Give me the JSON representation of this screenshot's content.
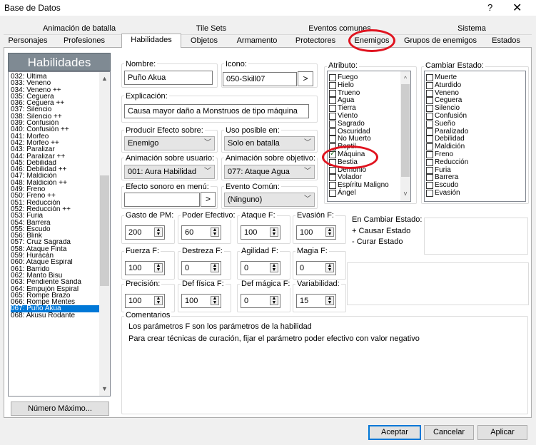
{
  "window": {
    "title": "Base de Datos",
    "help": "?",
    "close": "✕"
  },
  "tabs_row1": [
    "Animación de batalla",
    "Tile Sets",
    "Eventos comunes",
    "Sistema"
  ],
  "tabs_row2": [
    "Personajes",
    "Profesiones",
    "Habilidades",
    "Objetos",
    "Armamento",
    "Protectores",
    "Enemigos",
    "Grupos de enemigos",
    "Estados"
  ],
  "list": {
    "header": "Habilidades",
    "items": [
      "032: Última",
      "033: Veneno",
      "034: Veneno ++",
      "035: Ceguera",
      "036: Ceguera ++",
      "037: Silencio",
      "038: Silencio ++",
      "039: Confusión",
      "040: Confusión ++",
      "041: Morfeo",
      "042: Morfeo ++",
      "043: Paralizar",
      "044: Paralizar ++",
      "045: Debilidad",
      "046: Debilidad ++",
      "047: Maldición",
      "048: Maldición ++",
      "049: Freno",
      "050: Freno ++",
      "051: Reducción",
      "052: Reducción ++",
      "053: Furia",
      "054: Barrera",
      "055: Escudo",
      "056: Blink",
      "057: Cruz Sagrada",
      "058: Ataque Finta",
      "059: Huracán",
      "060: Ataque Espiral",
      "061: Barrido",
      "062: Manto Bisu",
      "063: Pendiente Sanda",
      "064: Empujón Espiral",
      "065: Rompe Brazo",
      "066: Rompe Mentes",
      "067: Puño Akua",
      "068: Akusu Rodante"
    ],
    "selected": "067: Puño Akua",
    "max_button": "Número Máximo..."
  },
  "form": {
    "nombre_label": "Nombre:",
    "nombre": "Puño Akua",
    "icono_label": "Icono:",
    "icono": "050-Skill07",
    "icono_btn": ">",
    "explicacion_label": "Explicación:",
    "explicacion": "Causa mayor daño a Monstruos de tipo máquina",
    "efecto_label": "Producir Efecto sobre:",
    "efecto": "Enemigo",
    "uso_label": "Uso posible en:",
    "uso": "Solo en batalla",
    "anim_user_label": "Animación sobre usuario:",
    "anim_user": "001: Aura Habilidad",
    "anim_target_label": "Animación sobre objetivo:",
    "anim_target": "077: Ataque Agua",
    "sonido_label": "Efecto sonoro en menú:",
    "sonido": "",
    "sonido_btn": ">",
    "evento_label": "Evento Común:",
    "evento": "(Ninguno)"
  },
  "stats": [
    {
      "label": "Gasto de PM:",
      "value": "200"
    },
    {
      "label": "Poder Efectivo:",
      "value": "60"
    },
    {
      "label": "Ataque F:",
      "value": "100"
    },
    {
      "label": "Evasión F:",
      "value": "100"
    },
    {
      "label": "Fuerza F:",
      "value": "100"
    },
    {
      "label": "Destreza F:",
      "value": "0"
    },
    {
      "label": "Agilidad F:",
      "value": "0"
    },
    {
      "label": "Magia F:",
      "value": "0"
    },
    {
      "label": "Precisión:",
      "value": "100"
    },
    {
      "label": "Def física F:",
      "value": "100"
    },
    {
      "label": "Def mágica F:",
      "value": "0"
    },
    {
      "label": "Variabilidad:",
      "value": "15"
    }
  ],
  "atributo": {
    "label": "Atributo:",
    "items": [
      {
        "name": "Fuego",
        "checked": false
      },
      {
        "name": "Hielo",
        "checked": false
      },
      {
        "name": "Trueno",
        "checked": false
      },
      {
        "name": "Agua",
        "checked": false
      },
      {
        "name": "Tierra",
        "checked": false
      },
      {
        "name": "Viento",
        "checked": false
      },
      {
        "name": "Sagrado",
        "checked": false
      },
      {
        "name": "Oscuridad",
        "checked": false
      },
      {
        "name": "No Muerto",
        "checked": false
      },
      {
        "name": "Reptil",
        "checked": false
      },
      {
        "name": "Máquina",
        "checked": true
      },
      {
        "name": "Bestia",
        "checked": false
      },
      {
        "name": "Demonio",
        "checked": false
      },
      {
        "name": "Volador",
        "checked": false
      },
      {
        "name": "Espíritu Maligno",
        "checked": false
      },
      {
        "name": "Ángel",
        "checked": false
      }
    ]
  },
  "estado": {
    "label": "Cambiar Estado:",
    "items": [
      "Muerte",
      "Aturdido",
      "Veneno",
      "Ceguera",
      "Silencio",
      "Confusión",
      "Sueño",
      "Paralizado",
      "Debilidad",
      "Maldición",
      "Freno",
      "Reducción",
      "Furia",
      "Barrera",
      "Escudo",
      "Evasión"
    ]
  },
  "en_cambiar": {
    "label": "En Cambiar Estado:",
    "add": "+ Causar Estado",
    "remove": "- Curar Estado"
  },
  "comentarios": {
    "label": "Comentarios",
    "lines": [
      "Los parámetros F son los parámetros de la habilidad",
      "Para crear técnicas de curación, fijar el parámetro poder efectivo con valor negativo"
    ]
  },
  "footer": {
    "ok": "Aceptar",
    "cancel": "Cancelar",
    "apply": "Aplicar"
  },
  "colors": {
    "selection": "#0078d7",
    "highlight_ring": "#e0131f",
    "list_header": "#7f8a93"
  }
}
